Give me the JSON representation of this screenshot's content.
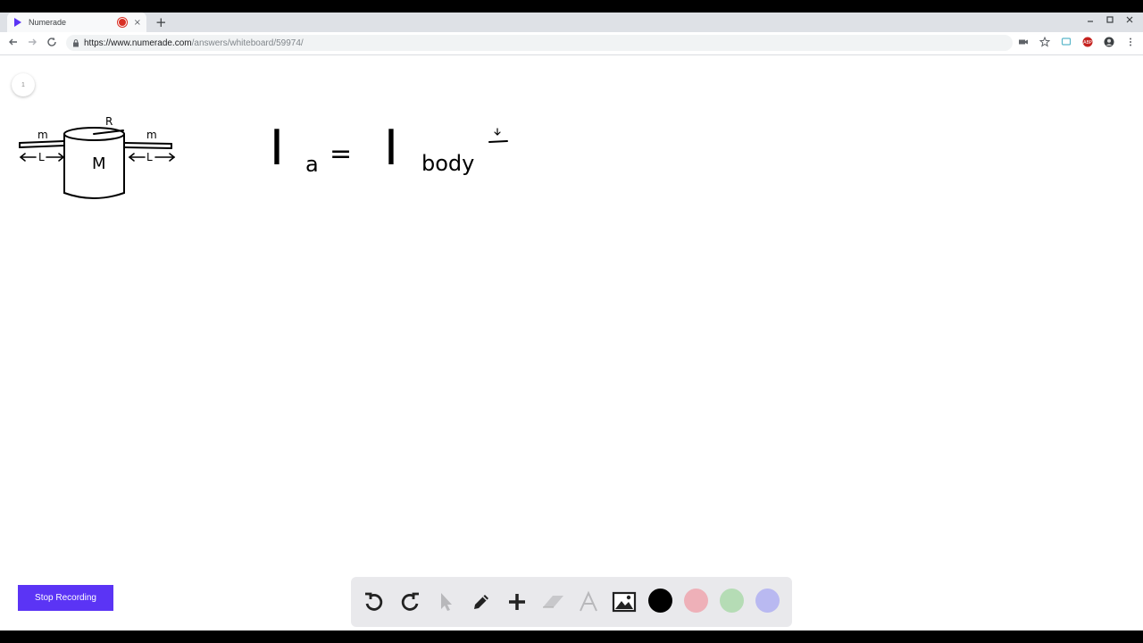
{
  "browser": {
    "tab_title": "Numerade",
    "tab_close": "×",
    "new_tab": "+",
    "url_host": "https://www.numerade.com",
    "url_path": "/answers/whiteboard/59974/"
  },
  "canvas": {
    "page_number": "1",
    "diagram": {
      "mass_big": "M",
      "mass_small_left": "m",
      "mass_small_right": "m",
      "radius": "R",
      "length_left": "L",
      "length_right": "L"
    },
    "equation": {
      "lhs": "I",
      "lhs_sub": "a",
      "equals": "=",
      "rhs": "I",
      "rhs_sub": "body"
    }
  },
  "recording": {
    "stop_label": "Stop Recording"
  },
  "toolbar": {
    "tools": [
      "undo-icon",
      "redo-icon",
      "pointer-icon",
      "pen-icon",
      "add-icon",
      "eraser-icon",
      "text-icon",
      "image-icon"
    ],
    "colors": [
      {
        "name": "black",
        "hex": "#000000"
      },
      {
        "name": "pink",
        "hex": "#eeb0b8"
      },
      {
        "name": "green",
        "hex": "#b5dcb5"
      },
      {
        "name": "purple",
        "hex": "#b9b9f1"
      }
    ],
    "accent": "#5b34f5"
  }
}
